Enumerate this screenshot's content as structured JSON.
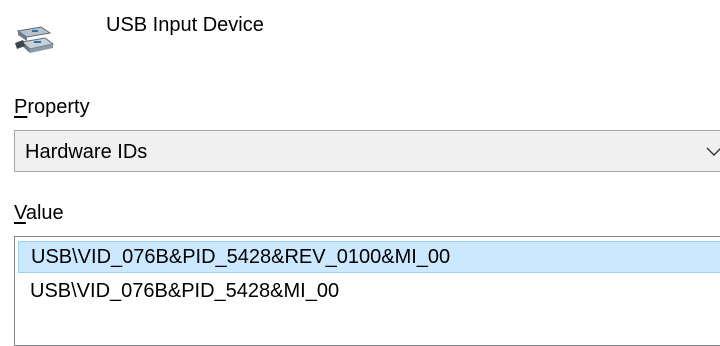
{
  "device": {
    "icon": "usb-device-icon",
    "name": "USB Input Device"
  },
  "property": {
    "label_accel": "P",
    "label_rest": "roperty",
    "selected": "Hardware IDs",
    "icon": "chevron-down-icon"
  },
  "value": {
    "label_accel": "V",
    "label_rest": "alue",
    "items": [
      {
        "text": "USB\\VID_076B&PID_5428&REV_0100&MI_00",
        "selected": true
      },
      {
        "text": "USB\\VID_076B&PID_5428&MI_00",
        "selected": false
      }
    ]
  },
  "colors": {
    "selection_background": "#cce8ff",
    "selection_border": "#99d1ff",
    "dropdown_background": "#f0f0f0"
  }
}
